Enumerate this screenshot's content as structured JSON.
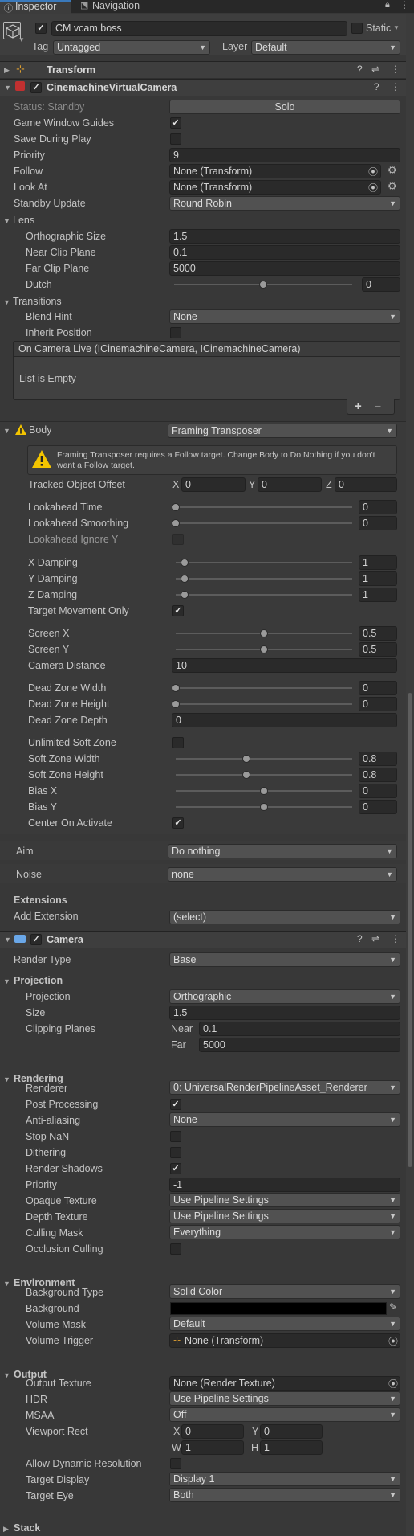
{
  "tabs": {
    "inspector": "Inspector",
    "navigation": "Navigation"
  },
  "object": {
    "name": "CM vcam boss",
    "static_label": "Static",
    "tag_label": "Tag",
    "tag_value": "Untagged",
    "layer_label": "Layer",
    "layer_value": "Default"
  },
  "transform": {
    "title": "Transform"
  },
  "cvc": {
    "title": "CinemachineVirtualCamera",
    "status": "Status: Standby",
    "solo": "Solo",
    "game_window_guides": "Game Window Guides",
    "save_during_play": "Save During Play",
    "priority_label": "Priority",
    "priority_value": "9",
    "follow_label": "Follow",
    "follow_value": "None (Transform)",
    "lookat_label": "Look At",
    "lookat_value": "None (Transform)",
    "standby_label": "Standby Update",
    "standby_value": "Round Robin"
  },
  "lens": {
    "title": "Lens",
    "ortho_label": "Orthographic Size",
    "ortho_value": "1.5",
    "near_label": "Near Clip Plane",
    "near_value": "0.1",
    "far_label": "Far Clip Plane",
    "far_value": "5000",
    "dutch_label": "Dutch",
    "dutch_value": "0",
    "dutch_fraction": 0.5
  },
  "transitions": {
    "title": "Transitions",
    "blend_label": "Blend Hint",
    "blend_value": "None",
    "inherit_label": "Inherit Position",
    "event_title": "On Camera Live (ICinemachineCamera, ICinemachineCamera)",
    "list_empty": "List is Empty",
    "plus": "+",
    "minus": "−"
  },
  "body": {
    "title": "Body",
    "value": "Framing Transposer",
    "warning": "Framing Transposer requires a Follow target.  Change Body to Do Nothing if you don't want a Follow target.",
    "tracked_label": "Tracked Object Offset",
    "x_label": "X",
    "x_value": "0",
    "y_label": "Y",
    "y_value": "0",
    "z_label": "Z",
    "z_value": "0",
    "lookahead_time_label": "Lookahead Time",
    "lookahead_time_value": "0",
    "lookahead_time_fraction": 0,
    "lookahead_smoothing_label": "Lookahead Smoothing",
    "lookahead_smoothing_value": "0",
    "lookahead_smoothing_fraction": 0,
    "lookahead_ignore_label": "Lookahead Ignore Y",
    "x_damping_label": "X Damping",
    "x_damping_value": "1",
    "x_damping_fraction": 0.05,
    "y_damping_label": "Y Damping",
    "y_damping_value": "1",
    "y_damping_fraction": 0.05,
    "z_damping_label": "Z Damping",
    "z_damping_value": "1",
    "z_damping_fraction": 0.05,
    "target_movement_label": "Target Movement Only",
    "screen_x_label": "Screen X",
    "screen_x_value": "0.5",
    "screen_x_fraction": 0.5,
    "screen_y_label": "Screen Y",
    "screen_y_value": "0.5",
    "screen_y_fraction": 0.5,
    "camera_distance_label": "Camera Distance",
    "camera_distance_value": "10",
    "dz_width_label": "Dead Zone Width",
    "dz_width_value": "0",
    "dz_width_fraction": 0,
    "dz_height_label": "Dead Zone Height",
    "dz_height_value": "0",
    "dz_height_fraction": 0,
    "dz_depth_label": "Dead Zone Depth",
    "dz_depth_value": "0",
    "unlimited_label": "Unlimited Soft Zone",
    "sz_width_label": "Soft Zone Width",
    "sz_width_value": "0.8",
    "sz_width_fraction": 0.4,
    "sz_height_label": "Soft Zone Height",
    "sz_height_value": "0.8",
    "sz_height_fraction": 0.4,
    "bias_x_label": "Bias X",
    "bias_x_value": "0",
    "bias_x_fraction": 0.5,
    "bias_y_label": "Bias Y",
    "bias_y_value": "0",
    "bias_y_fraction": 0.5,
    "center_label": "Center On Activate"
  },
  "aim": {
    "label": "Aim",
    "value": "Do nothing"
  },
  "noise": {
    "label": "Noise",
    "value": "none"
  },
  "extensions": {
    "title": "Extensions",
    "add_label": "Add Extension",
    "add_value": "(select)"
  },
  "camera": {
    "title": "Camera",
    "render_type_label": "Render Type",
    "render_type_value": "Base",
    "projection_title": "Projection",
    "projection_label": "Projection",
    "projection_value": "Orthographic",
    "size_label": "Size",
    "size_value": "1.5",
    "clipping_label": "Clipping Planes",
    "near_label": "Near",
    "near_value": "0.1",
    "far_label": "Far",
    "far_value": "5000",
    "rendering_title": "Rendering",
    "renderer_label": "Renderer",
    "renderer_value": "0: UniversalRenderPipelineAsset_Renderer",
    "post_label": "Post Processing",
    "aa_label": "Anti-aliasing",
    "aa_value": "None",
    "stopnan_label": "Stop NaN",
    "dithering_label": "Dithering",
    "shadows_label": "Render Shadows",
    "priority_label": "Priority",
    "priority_value": "-1",
    "opaque_label": "Opaque Texture",
    "opaque_value": "Use Pipeline Settings",
    "depth_label": "Depth Texture",
    "depth_value": "Use Pipeline Settings",
    "culling_label": "Culling Mask",
    "culling_value": "Everything",
    "occlusion_label": "Occlusion Culling",
    "environment_title": "Environment",
    "bg_type_label": "Background Type",
    "bg_type_value": "Solid Color",
    "bg_label": "Background",
    "bg_color": "#000000",
    "volume_mask_label": "Volume Mask",
    "volume_mask_value": "Default",
    "volume_trigger_label": "Volume Trigger",
    "volume_trigger_value": "None (Transform)",
    "output_title": "Output",
    "output_tex_label": "Output Texture",
    "output_tex_value": "None (Render Texture)",
    "hdr_label": "HDR",
    "hdr_value": "Use Pipeline Settings",
    "msaa_label": "MSAA",
    "msaa_value": "Off",
    "viewport_label": "Viewport Rect",
    "vx_label": "X",
    "vx_value": "0",
    "vy_label": "Y",
    "vy_value": "0",
    "vw_label": "W",
    "vw_value": "1",
    "vh_label": "H",
    "vh_value": "1",
    "dyn_res_label": "Allow Dynamic Resolution",
    "target_display_label": "Target Display",
    "target_display_value": "Display 1",
    "target_eye_label": "Target Eye",
    "target_eye_value": "Both",
    "stack_title": "Stack"
  }
}
